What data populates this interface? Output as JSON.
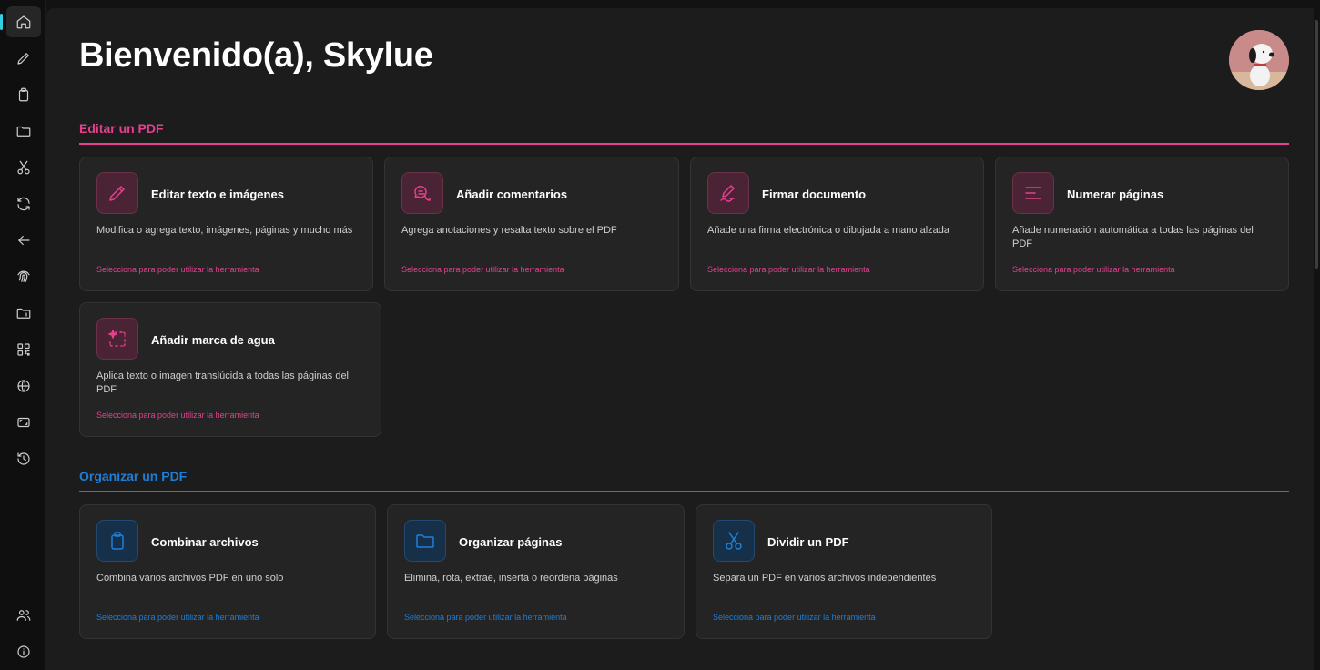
{
  "header": {
    "welcome": "Bienvenido(a), Skylue"
  },
  "colors": {
    "accent_pink": "#e4408e",
    "accent_blue": "#1e7fd8",
    "active_indicator": "#2fd0e6"
  },
  "rail": {
    "top_icons": [
      "home-icon",
      "pencil-icon",
      "clipboard-icon",
      "folder-icon",
      "scissors-icon",
      "refresh-icon",
      "arrow-left-icon",
      "fingerprint-icon",
      "folder-id-icon",
      "qr-code-icon",
      "globe-icon",
      "frame-icon",
      "history-icon"
    ],
    "bottom_icons": [
      "users-icon",
      "info-icon"
    ]
  },
  "sections": [
    {
      "title": "Editar un PDF",
      "cards": [
        {
          "title": "Editar texto e imágenes",
          "desc": "Modifica o agrega texto, imágenes, páginas y mucho más",
          "hint": "Selecciona para poder utilizar la herramienta",
          "icon": "pencil-icon"
        },
        {
          "title": "Añadir comentarios",
          "desc": "Agrega anotaciones y resalta texto sobre el PDF",
          "hint": "Selecciona para poder utilizar la herramienta",
          "icon": "comments-icon"
        },
        {
          "title": "Firmar documento",
          "desc": "Añade una firma electrónica o dibujada a mano alzada",
          "hint": "Selecciona para poder utilizar la herramienta",
          "icon": "signature-icon"
        },
        {
          "title": "Numerar páginas",
          "desc": "Añade numeración automática a todas las páginas del PDF",
          "hint": "Selecciona para poder utilizar la herramienta",
          "icon": "lines-icon"
        },
        {
          "title": "Añadir marca de agua",
          "desc": "Aplica texto o imagen translúcida a todas las páginas del PDF",
          "hint": "Selecciona para poder utilizar la herramienta",
          "icon": "watermark-icon"
        }
      ]
    },
    {
      "title": "Organizar un PDF",
      "cards": [
        {
          "title": "Combinar archivos",
          "desc": "Combina varios archivos PDF en uno solo",
          "hint": "Selecciona para poder utilizar la herramienta",
          "icon": "clipboard-icon"
        },
        {
          "title": "Organizar páginas",
          "desc": "Elimina, rota, extrae, inserta o reordena páginas",
          "hint": "Selecciona para poder utilizar la herramienta",
          "icon": "folder-icon"
        },
        {
          "title": "Dividir un PDF",
          "desc": "Separa un PDF en varios archivos independientes",
          "hint": "Selecciona para poder utilizar la herramienta",
          "icon": "scissors-icon"
        }
      ]
    }
  ]
}
